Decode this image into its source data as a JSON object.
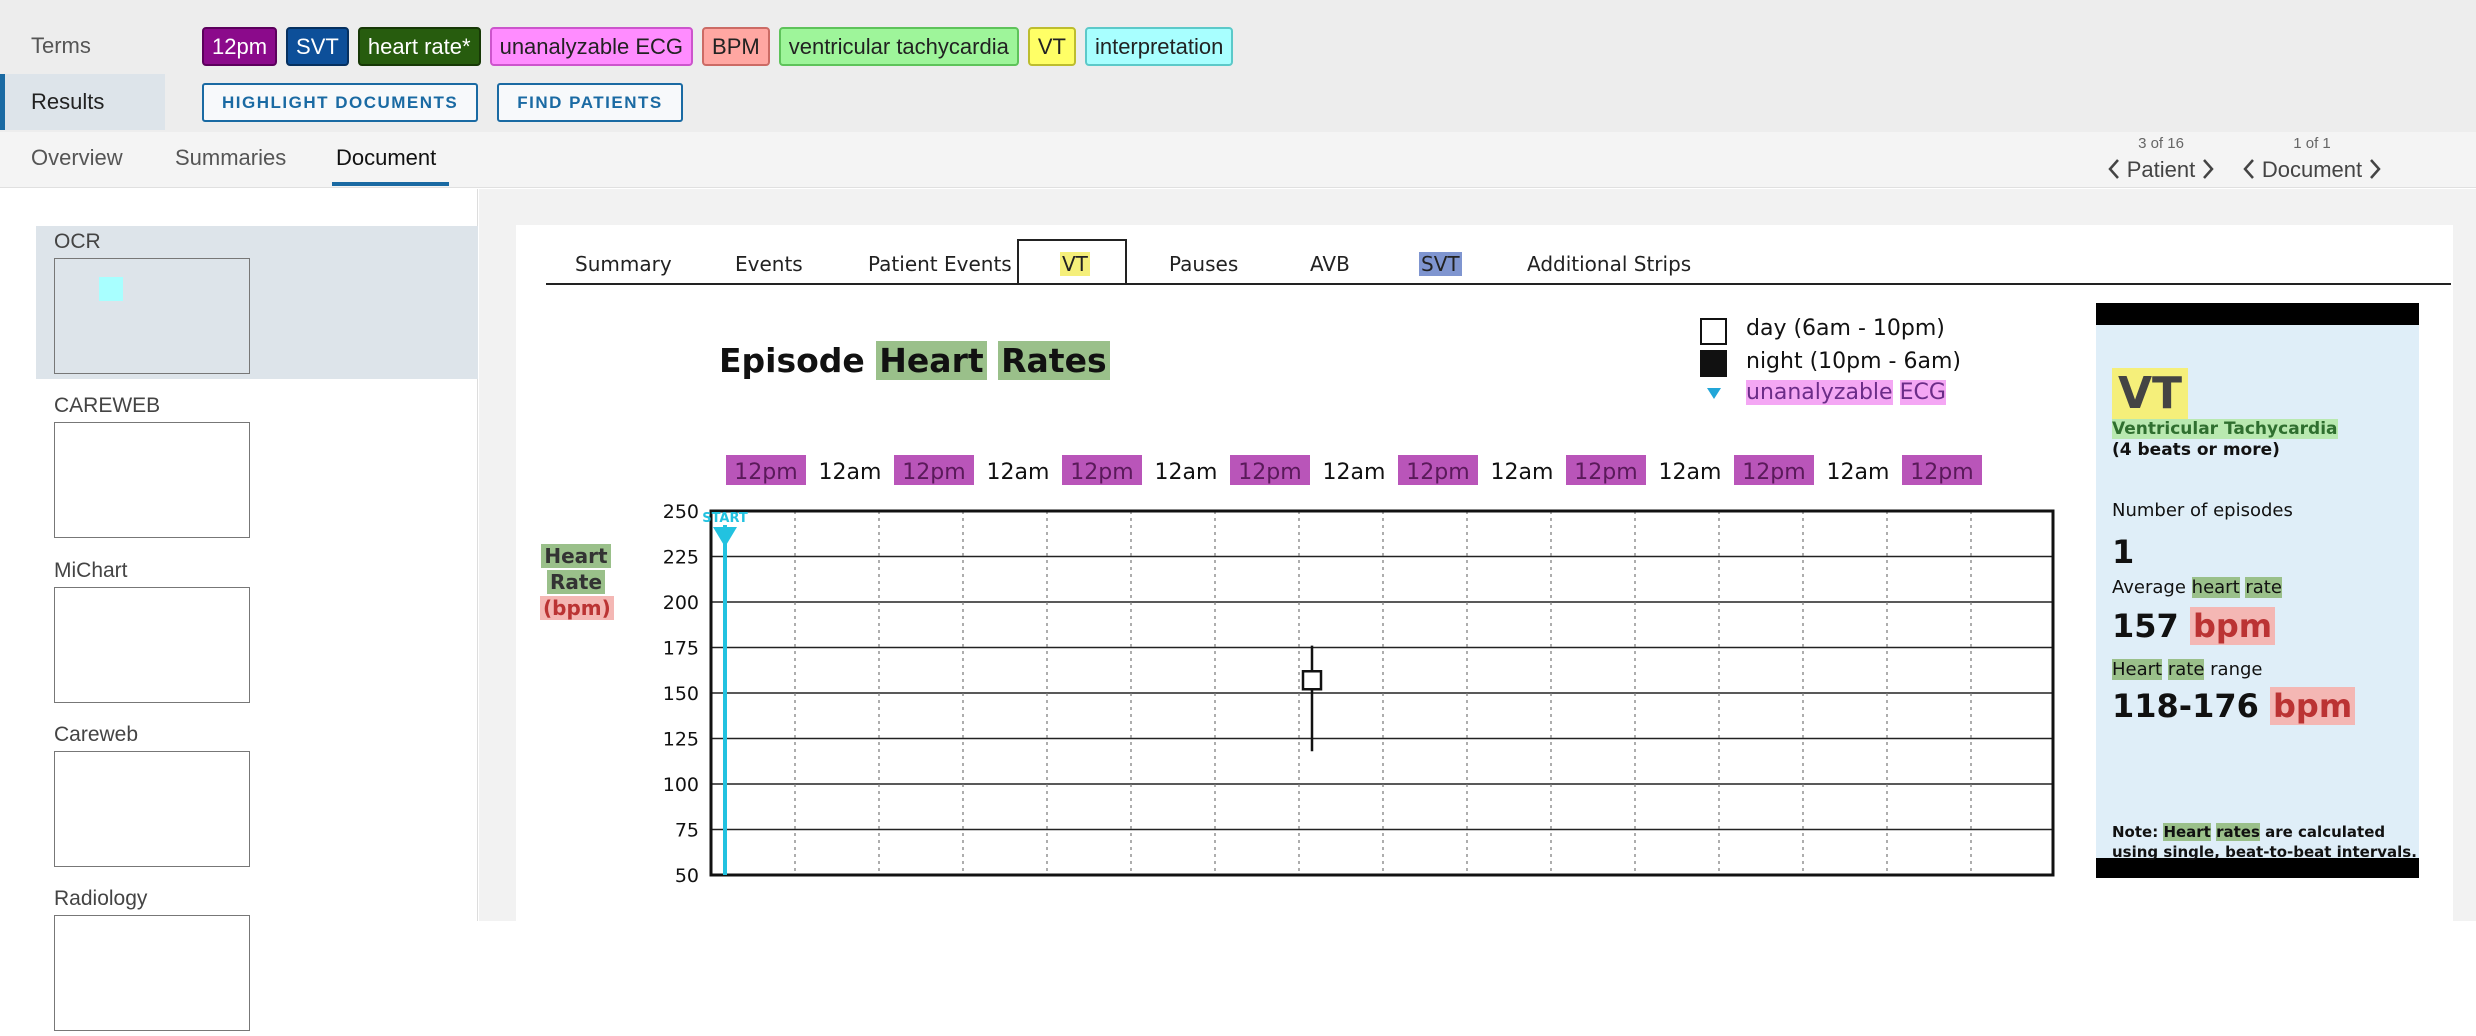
{
  "terms": {
    "label": "Terms",
    "chips": [
      {
        "text": "12pm",
        "bg": "#8b0a8b",
        "fg": "#ffffff",
        "border": "#5c005c"
      },
      {
        "text": "SVT",
        "bg": "#0d4f99",
        "fg": "#ffffff",
        "border": "#06305f"
      },
      {
        "text": "heart rate*",
        "bg": "#275c0e",
        "fg": "#ffffff",
        "border": "#173806"
      },
      {
        "text": "unanalyzable ECG",
        "bg": "#ff8cff",
        "fg": "#222222",
        "border": "#cc55cc"
      },
      {
        "text": "BPM",
        "bg": "#ffa7a2",
        "fg": "#222222",
        "border": "#cc6b65"
      },
      {
        "text": "ventricular tachycardia",
        "bg": "#9ef59a",
        "fg": "#222222",
        "border": "#5ec35a"
      },
      {
        "text": "VT",
        "bg": "#ffff66",
        "fg": "#222222",
        "border": "#bdbd2e"
      },
      {
        "text": "interpretation",
        "bg": "#a8ffff",
        "fg": "#222222",
        "border": "#5cc9c9"
      }
    ]
  },
  "results": {
    "label": "Results",
    "highlight_button": "HIGHLIGHT DOCUMENTS",
    "find_button": "FIND PATIENTS"
  },
  "view_tabs": [
    "Overview",
    "Summaries",
    "Document"
  ],
  "active_view_tab": "Document",
  "pager": {
    "patient": {
      "count": "3 of 16",
      "label": "Patient"
    },
    "document": {
      "count": "1 of 1",
      "label": "Document"
    }
  },
  "sources": [
    {
      "label": "OCR",
      "active": true
    },
    {
      "label": "CAREWEB",
      "active": false
    },
    {
      "label": "MiChart",
      "active": false
    },
    {
      "label": "Careweb",
      "active": false
    },
    {
      "label": "Radiology",
      "active": false
    }
  ],
  "document": {
    "tabs": [
      "Summary",
      "Events",
      "Patient Events",
      "VT",
      "Pauses",
      "AVB",
      "SVT",
      "Additional Strips"
    ],
    "active_tab": "VT",
    "title": {
      "prefix": "Episode",
      "word1": "Heart",
      "word2": "Rates"
    },
    "legend": {
      "day": "day (6am - 10pm)",
      "night": "night (10pm - 6am)",
      "unanalyzable_a": "unanalyzable",
      "unanalyzable_b": "ECG"
    },
    "y_label": {
      "line1": "Heart",
      "line2": "Rate",
      "line3": "(bpm)"
    },
    "start_marker": "START"
  },
  "chart_data": {
    "type": "scatter",
    "title": "",
    "ylabel": "",
    "ylim": [
      50,
      250
    ],
    "y_ticks": [
      250,
      225,
      200,
      175,
      150,
      125,
      100,
      75,
      50
    ],
    "x_tick_labels": [
      "12pm",
      "12am",
      "12pm",
      "12am",
      "12pm",
      "12am",
      "12pm",
      "12am",
      "12pm",
      "12am",
      "12pm",
      "12am",
      "12pm",
      "12am",
      "12pm"
    ],
    "grid": true,
    "series": [
      {
        "points": [
          {
            "tick": 6.5,
            "y": 157,
            "min": 118,
            "max": 176
          }
        ]
      }
    ],
    "colors": {
      "start": "#22c2e0",
      "highlight": "#b955b9"
    }
  },
  "vt_panel": {
    "code": "VT",
    "name": "Ventricular Tachycardia",
    "beats": "(4 beats or more)",
    "episodes_label": "Number of episodes",
    "episodes_value": "1",
    "avg_label_prefix": "Average",
    "avg_label_w1": "heart",
    "avg_label_w2": "rate",
    "avg_value": "157",
    "unit": "bpm",
    "range_label_w1": "Heart",
    "range_label_w2": "rate",
    "range_label_suffix": "range",
    "range_value": "118-176",
    "note_prefix": "Note:",
    "note_w1": "Heart",
    "note_w2": "rates",
    "note_rest1": "are calculated",
    "note_rest2": "using single, beat-to-beat intervals."
  }
}
